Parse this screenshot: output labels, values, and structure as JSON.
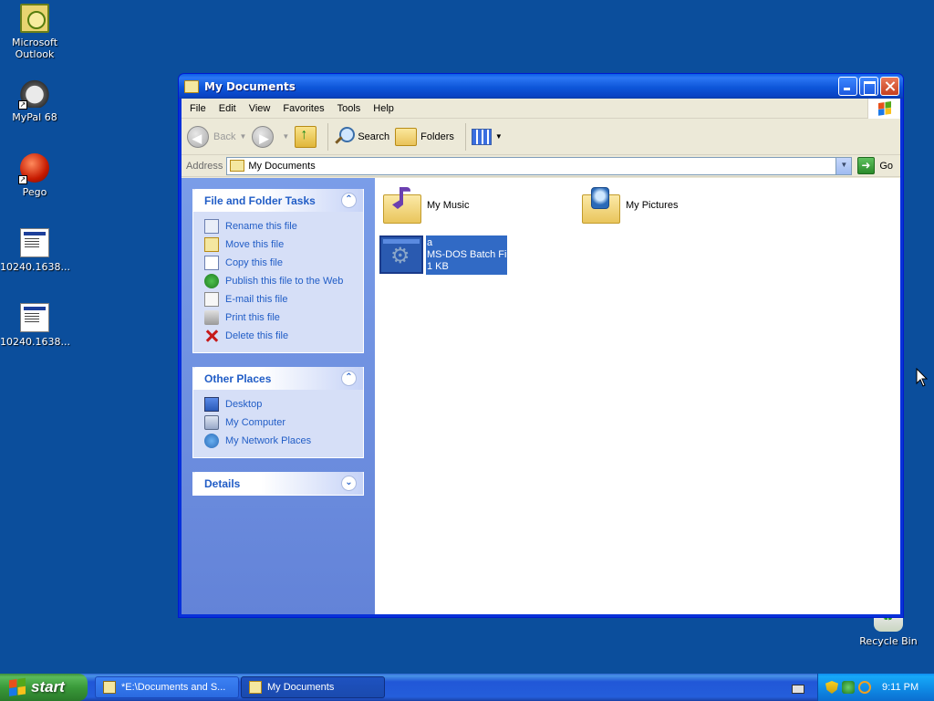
{
  "desktop": {
    "icons": [
      {
        "label": "Microsoft Outlook",
        "icon": "outlook-icon"
      },
      {
        "label": "MyPal 68",
        "icon": "raccoon-icon"
      },
      {
        "label": "Pego",
        "icon": "pego-icon"
      },
      {
        "label": "10240.1638...",
        "icon": "document-file-icon"
      },
      {
        "label": "10240.1638...",
        "icon": "document-file-icon"
      },
      {
        "label": "Recycle Bin",
        "icon": "recycle-bin-icon"
      }
    ]
  },
  "window": {
    "title": "My Documents",
    "menu": [
      "File",
      "Edit",
      "View",
      "Favorites",
      "Tools",
      "Help"
    ],
    "toolbar": {
      "back": "Back",
      "search": "Search",
      "folders": "Folders"
    },
    "address": {
      "label": "Address",
      "value": "My Documents",
      "go": "Go"
    },
    "file_tasks": {
      "title": "File and Folder Tasks",
      "items": [
        "Rename this file",
        "Move this file",
        "Copy this file",
        "Publish this file to the Web",
        "E-mail this file",
        "Print this file",
        "Delete this file"
      ]
    },
    "other_places": {
      "title": "Other Places",
      "items": [
        "Desktop",
        "My Computer",
        "My Network Places"
      ]
    },
    "details": {
      "title": "Details"
    },
    "files": [
      {
        "name": "My Music",
        "type": "folder"
      },
      {
        "name": "My Pictures",
        "type": "folder"
      },
      {
        "name": "a",
        "kind": "MS-DOS Batch File",
        "size": "1 KB",
        "selected": true
      }
    ]
  },
  "taskbar": {
    "start": "start",
    "tasks": [
      {
        "label": "*E:\\Documents and S...",
        "active": false
      },
      {
        "label": "My Documents",
        "active": true
      }
    ],
    "clock": "9:11 PM"
  },
  "colors": {
    "desktop": "#0b4e9c",
    "titlebar": "#0a5fe8",
    "taskpane": "#7a9de8",
    "selection": "#316ac5",
    "link": "#215dc6"
  }
}
